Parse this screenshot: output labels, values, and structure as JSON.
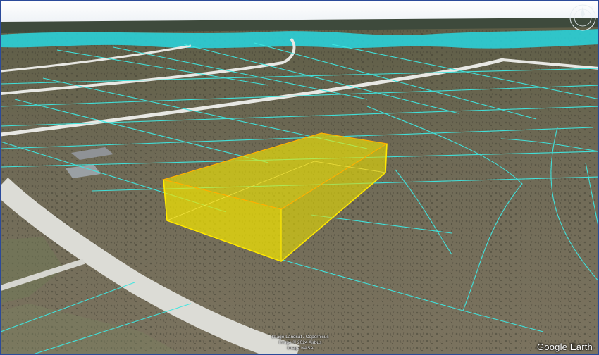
{
  "map": {
    "app": "Google Earth",
    "attribution": [
      "Image Landsat / Copernicus",
      "Image © 2024 Airbus",
      "Image NASA"
    ],
    "top_marker": "s",
    "colors": {
      "parcel_lines": "#3fe6e0",
      "highlight_fill": "#f4ea00",
      "highlight_edge": "#ffe800",
      "road": "#e8e8e4",
      "terrain": "#6e6a55",
      "water": "#28d7e0"
    },
    "icons": {
      "compass": "compass-icon"
    }
  }
}
